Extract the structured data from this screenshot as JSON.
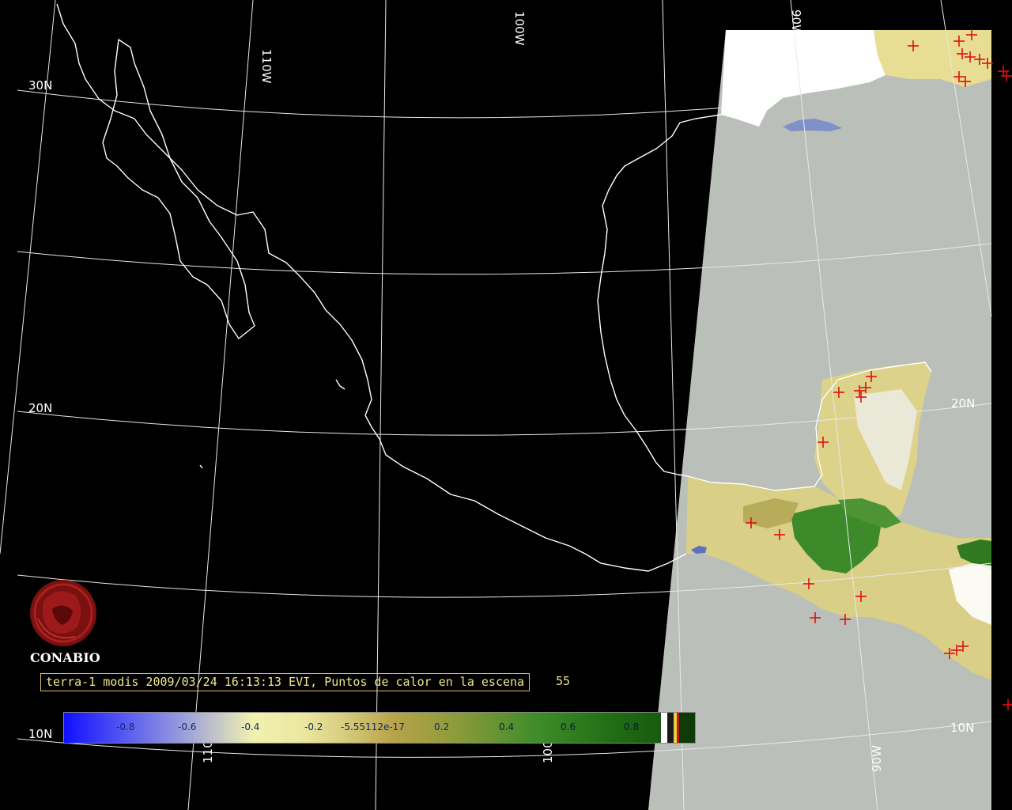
{
  "logo": {
    "name": "CONABIO"
  },
  "caption": {
    "text": "terra-1 modis 2009/03/24 16:13:13 EVI, Puntos de calor en la escena",
    "count": "55"
  },
  "grid_labels": {
    "lon_110_top": "110W",
    "lon_100_top": "100W",
    "lon_90_top": "90W",
    "lon_110_bottom": "110W",
    "lon_100_bottom": "100W",
    "lon_90_bottom": "90W",
    "lat_30_left": "30N",
    "lat_20_left": "20N",
    "lat_20_right": "20N",
    "lat_10_left": "10N",
    "lat_10_right": "10N"
  },
  "colorbar": {
    "tick_labels": [
      "-0.8",
      "-0.6",
      "-0.4",
      "-0.2",
      "-5.55112e-17",
      "0.2",
      "0.4",
      "0.6",
      "0.8"
    ]
  },
  "colors": {
    "background": "#000000",
    "water": "#bbbfb9",
    "cloud": "#ffffff",
    "hotspot": "#e01010",
    "caption_text": "#f1e68a"
  }
}
